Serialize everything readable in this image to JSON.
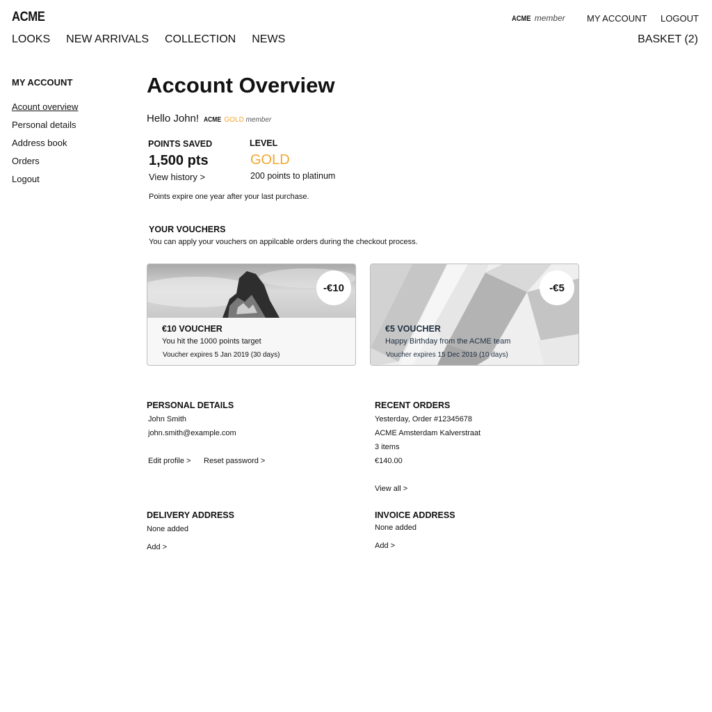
{
  "header": {
    "logo": "ACME",
    "member_badge": {
      "brand": "ACME",
      "label": "member"
    },
    "top_links": [
      "MY ACCOUNT",
      "LOGOUT"
    ],
    "nav": [
      "LOOKS",
      "NEW ARRIVALS",
      "COLLECTION",
      "NEWS"
    ],
    "basket": "BASKET (2)"
  },
  "sidebar": {
    "title": "MY ACCOUNT",
    "items": [
      {
        "label": "Acount overview",
        "active": true
      },
      {
        "label": "Personal details"
      },
      {
        "label": "Address book"
      },
      {
        "label": "Orders"
      },
      {
        "label": "Logout"
      }
    ]
  },
  "main": {
    "title": "Account Overview",
    "greeting": "Hello John!",
    "tier_badge": {
      "brand": "ACME",
      "tier": "GOLD",
      "label": "member"
    },
    "points": {
      "label": "POINTS SAVED",
      "value": "1,500 pts",
      "link": "View history >"
    },
    "level": {
      "label": "LEVEL",
      "value": "GOLD",
      "sub": "200 points to platinum"
    },
    "expire_note": "Points expire one year after your last purchase.",
    "vouchers": {
      "title": "YOUR VOUCHERS",
      "description": "You can apply your vouchers on appilcable orders during the checkout process.",
      "items": [
        {
          "badge": "-€10",
          "title": "€10 VOUCHER",
          "description": "You hit the 1000 points target",
          "expiry": "Voucher expires 5 Jan 2019 (30 days)",
          "image": "mountain-photo"
        },
        {
          "badge": "-€5",
          "title": "€5 VOUCHER",
          "description": "Happy Birthday from the ACME team",
          "expiry": "Voucher expires 15 Dec 2019 (10 days)",
          "image": "geometric-pattern"
        }
      ]
    },
    "personal_details": {
      "title": "PERSONAL DETAILS",
      "name": "John Smith",
      "email": "john.smith@example.com",
      "edit_link": "Edit profile >",
      "reset_link": "Reset password >"
    },
    "recent_orders": {
      "title": "RECENT ORDERS",
      "when": "Yesterday, Order #12345678",
      "store": "ACME Amsterdam Kalverstraat",
      "items": "3 items",
      "total": "€140.00",
      "view_all": "View all >"
    },
    "delivery_address": {
      "title": "DELIVERY ADDRESS",
      "value": "None added",
      "link": "Add >"
    },
    "invoice_address": {
      "title": "INVOICE ADDRESS",
      "value": "None added",
      "link": "Add >"
    }
  },
  "colors": {
    "gold": "#f0a830",
    "text": "#111111",
    "voucher_text_dark": "#1e2e40"
  }
}
